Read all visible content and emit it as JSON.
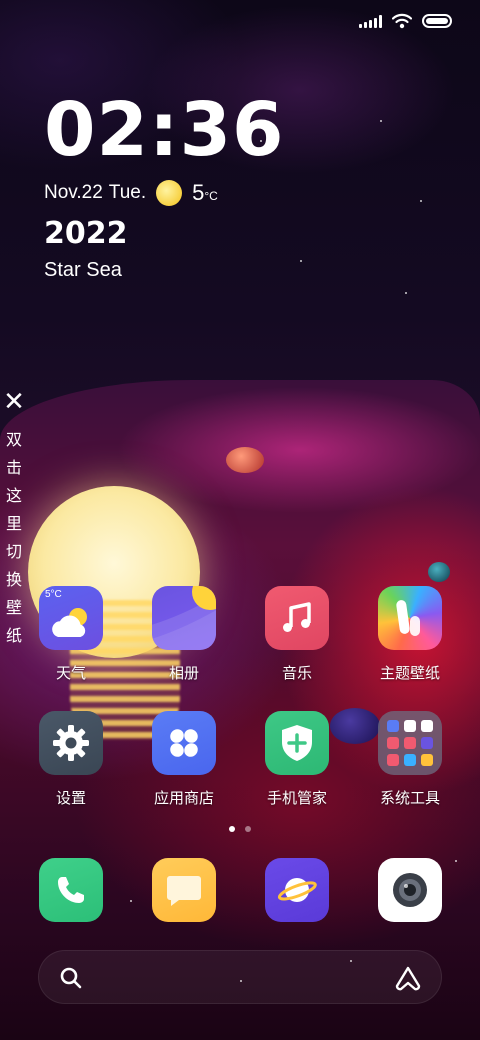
{
  "status_bar": {
    "icons": [
      "signal-icon",
      "wifi-icon",
      "battery-icon"
    ]
  },
  "clock_widget": {
    "time": "02:36",
    "date": "Nov.22",
    "weekday": "Tue.",
    "weather_icon": "sun-icon",
    "temperature": "5",
    "temperature_unit": "°C",
    "year": "2022",
    "location": "Star Sea"
  },
  "wallpaper_switch": {
    "close_glyph": "✕",
    "hint_chars": [
      "双",
      "击",
      "这",
      "里",
      "切",
      "换",
      "壁",
      "纸"
    ]
  },
  "apps": {
    "weather": {
      "label": "天气",
      "badge": "5°C",
      "icon": "weather-icon"
    },
    "gallery": {
      "label": "相册",
      "icon": "gallery-icon"
    },
    "music": {
      "label": "音乐",
      "icon": "music-icon"
    },
    "themes": {
      "label": "主题壁纸",
      "icon": "theme-icon"
    },
    "settings": {
      "label": "设置",
      "icon": "gear-icon"
    },
    "app_store": {
      "label": "应用商店",
      "icon": "app-store-icon"
    },
    "security": {
      "label": "手机管家",
      "icon": "shield-plus-icon"
    },
    "tools": {
      "label": "系统工具",
      "icon": "folder-icon"
    }
  },
  "page_indicator": {
    "pages": 2,
    "current": 1
  },
  "dock": {
    "icons": [
      "phone-icon",
      "messages-icon",
      "browser-icon",
      "camera-icon"
    ]
  },
  "search_bar": {
    "search_icon": "search-icon",
    "assistant_icon": "assistant-icon"
  },
  "colors": {
    "accent_green": "#3ec886",
    "accent_blue": "#5a7cf5",
    "accent_red": "#f05a70",
    "accent_yellow": "#ffc23a"
  }
}
